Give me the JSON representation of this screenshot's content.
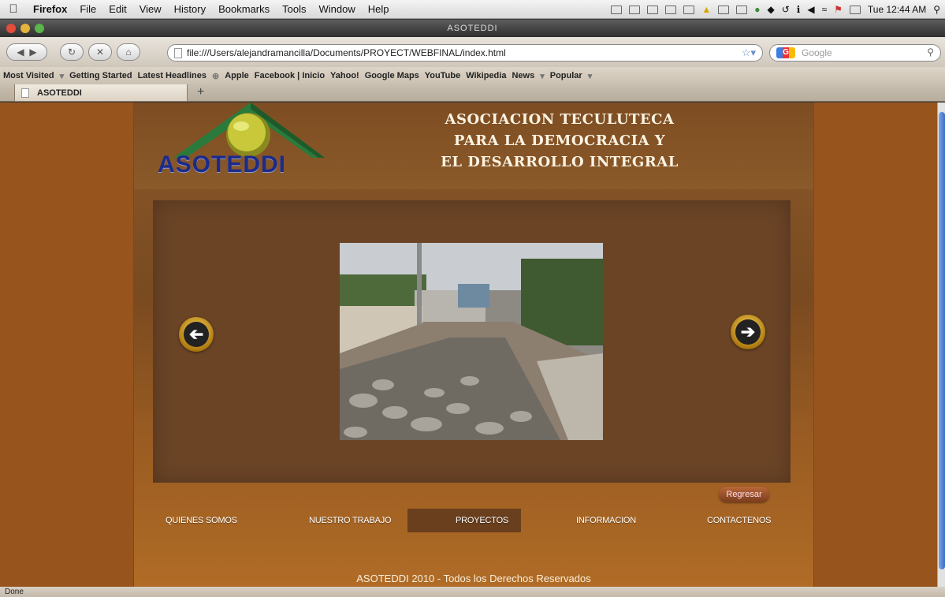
{
  "menubar": {
    "app": "Firefox",
    "items": [
      "File",
      "Edit",
      "View",
      "History",
      "Bookmarks",
      "Tools",
      "Window",
      "Help"
    ],
    "clock": "Tue 12:44 AM"
  },
  "window": {
    "title": "ASOTEDDI"
  },
  "toolbar": {
    "url": "file:///Users/alejandramancilla/Documents/PROYECT/WEBFINAL/index.html",
    "search_placeholder": "Google",
    "search_engine_badge": "G"
  },
  "bookmarks": [
    "Most Visited",
    "Getting Started",
    "Latest Headlines",
    "Apple",
    "Facebook | Inicio",
    "Yahoo!",
    "Google Maps",
    "YouTube",
    "Wikipedia",
    "News",
    "Popular"
  ],
  "tab": {
    "label": "ASOTEDDI",
    "new_tab": "+"
  },
  "page": {
    "logo_text": "ASOTEDDI",
    "title_lines": [
      "ASOCIACION TECULUTECA",
      "PARA LA DEMOCRACIA Y",
      "EL DESARROLLO INTEGRAL"
    ],
    "back_button": "Regresar",
    "nav": [
      "QUIENES SOMOS",
      "NUESTRO TRABAJO",
      "PROYECTOS",
      "INFORMACION",
      "CONTACTENOS"
    ],
    "active_nav": "PROYECTOS",
    "footer": "ASOTEDDI 2010 - Todos los Derechos Reservados"
  },
  "status": {
    "text": "Done"
  },
  "colors": {
    "page_bg": "#98541d",
    "slider_bg": "#6b4426",
    "accent_gold": "#d8a020"
  }
}
